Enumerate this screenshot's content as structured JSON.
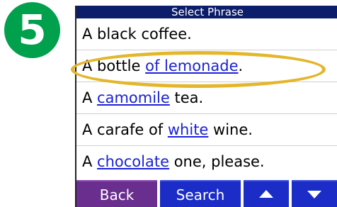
{
  "step_badge": "5",
  "title": "Select Phrase",
  "items": [
    {
      "pre": "A black coffee.",
      "kw": "",
      "post": ""
    },
    {
      "pre": "A bottle ",
      "kw": "of lemonade",
      "post": "."
    },
    {
      "pre": "A ",
      "kw": "camomile",
      "post": " tea."
    },
    {
      "pre": "A carafe of ",
      "kw": "white",
      "post": " wine."
    },
    {
      "pre": "A ",
      "kw": "chocolate",
      "post": " one, please."
    }
  ],
  "toolbar": {
    "back": "Back",
    "search": "Search",
    "up_icon": "up-arrow-icon",
    "down_icon": "down-arrow-icon"
  },
  "colors": {
    "badge": "#00a04c",
    "titlebar": "#0c1e6b",
    "link": "#1b22d7",
    "back": "#6a2e8f",
    "button": "#1b2cc7",
    "highlight": "#e3b62b"
  }
}
